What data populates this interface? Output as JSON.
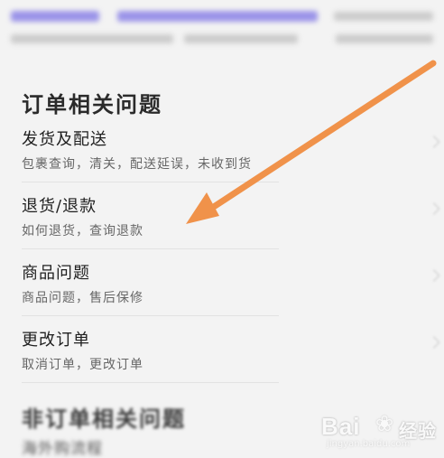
{
  "sections": {
    "order": {
      "title": "订单相关问题",
      "items": [
        {
          "title": "发货及配送",
          "desc": "包裹查询，清关，配送延误，未收到货"
        },
        {
          "title": "退货/退款",
          "desc": "如何退货，查询退款"
        },
        {
          "title": "商品问题",
          "desc": "商品问题，售后保修"
        },
        {
          "title": "更改订单",
          "desc": "取消订单，更改订单"
        }
      ]
    },
    "non_order": {
      "title": "非订单相关问题",
      "first_item": "海外购流程"
    }
  },
  "watermark": {
    "logo": "Bai",
    "paw": "❀",
    "logo_tail": "经验",
    "sub": "jingyan.baidu.com"
  },
  "colors": {
    "arrow": "#f0924a",
    "blur_link": "#8b82e6",
    "background": "#f3f3f3"
  }
}
